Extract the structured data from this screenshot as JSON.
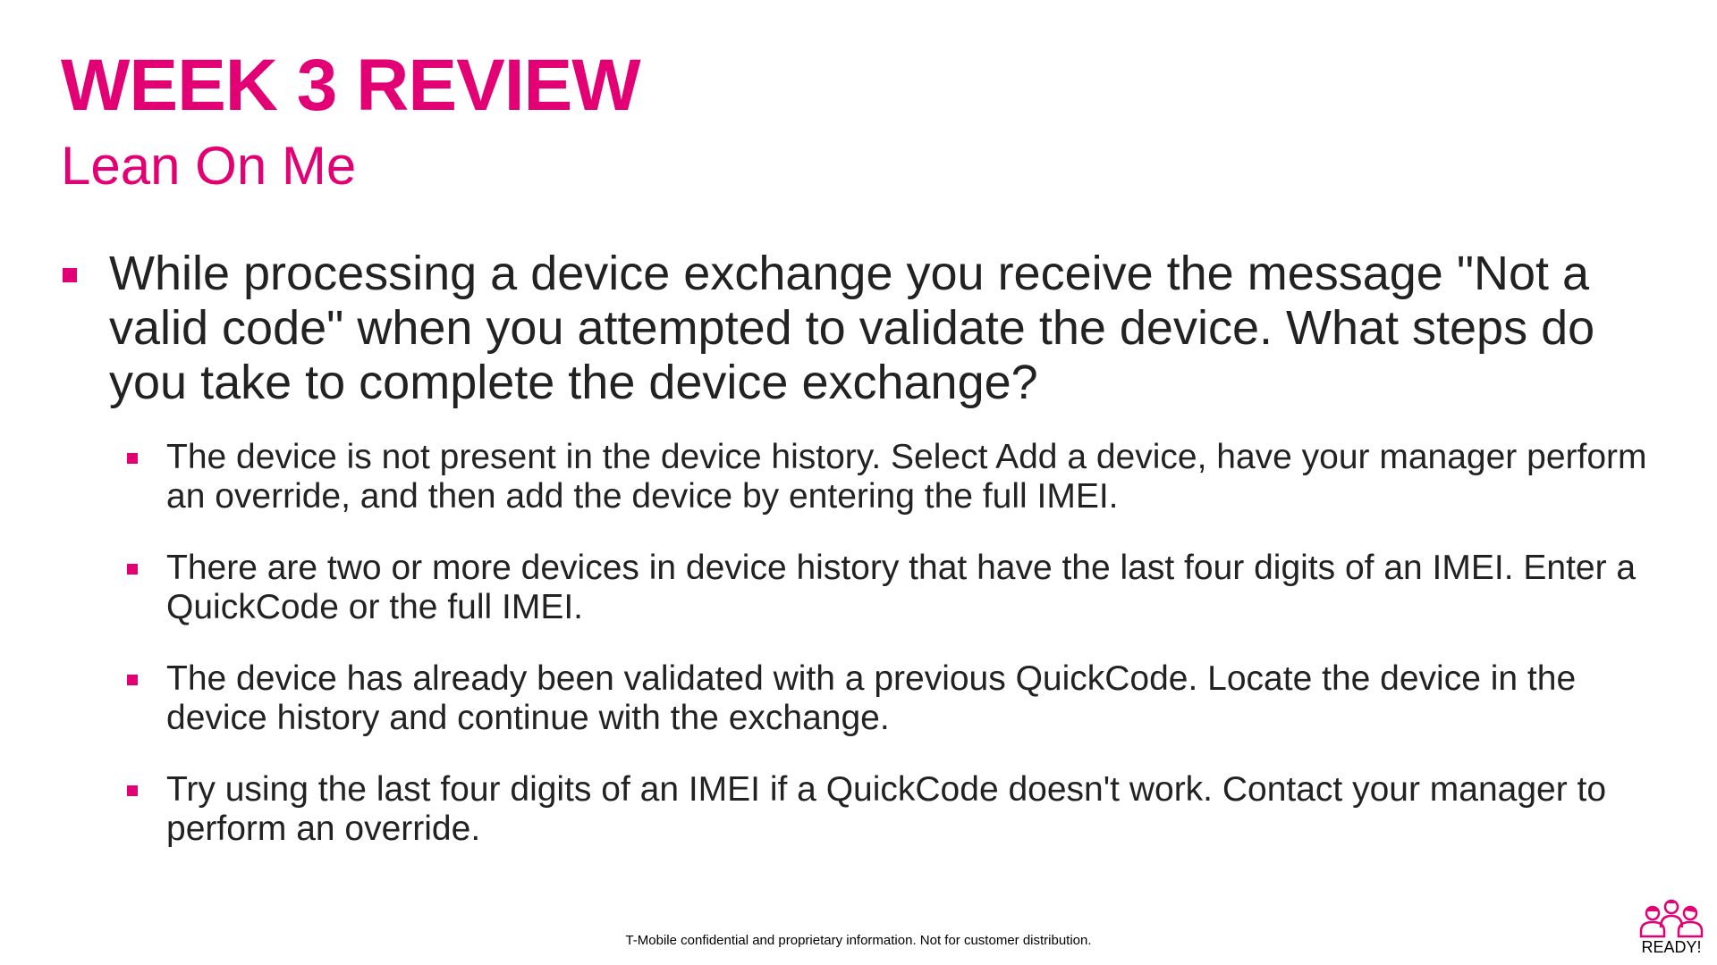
{
  "slide": {
    "title": "WEEK 3 REVIEW",
    "subtitle": "Lean On Me",
    "question": "While processing a device exchange you receive the message \"Not a valid code\" when you attempted to validate the device. What steps do you take to complete the device exchange?",
    "answers": [
      "The device is not present in the device history. Select Add a device, have your manager perform an override, and then add the device by entering the full IMEI.",
      "There are two or more devices in device history that have the last four digits of an IMEI. Enter a QuickCode or the full IMEI.",
      "The device has already been validated with a previous QuickCode. Locate the device in the device history and continue with the exchange.",
      "Try using the last four digits of an IMEI if a QuickCode doesn't work. Contact your manager to perform an override."
    ],
    "footer": "T-Mobile confidential and proprietary information. Not for customer distribution.",
    "logo_text": "READY!"
  },
  "colors": {
    "accent": "#e20074",
    "text": "#222222",
    "background": "#ffffff"
  },
  "icons": {
    "bullet": "square-bullet-icon",
    "logo": "ready-team-logo-icon"
  }
}
